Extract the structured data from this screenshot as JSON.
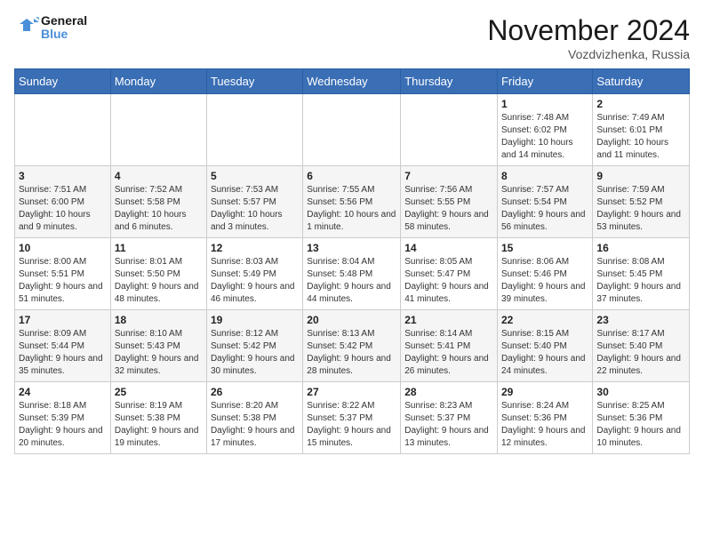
{
  "logo": {
    "line1": "General",
    "line2": "Blue"
  },
  "title": "November 2024",
  "location": "Vozdvizhenka, Russia",
  "weekdays": [
    "Sunday",
    "Monday",
    "Tuesday",
    "Wednesday",
    "Thursday",
    "Friday",
    "Saturday"
  ],
  "weeks": [
    [
      {
        "day": "",
        "info": ""
      },
      {
        "day": "",
        "info": ""
      },
      {
        "day": "",
        "info": ""
      },
      {
        "day": "",
        "info": ""
      },
      {
        "day": "",
        "info": ""
      },
      {
        "day": "1",
        "info": "Sunrise: 7:48 AM\nSunset: 6:02 PM\nDaylight: 10 hours and 14 minutes."
      },
      {
        "day": "2",
        "info": "Sunrise: 7:49 AM\nSunset: 6:01 PM\nDaylight: 10 hours and 11 minutes."
      }
    ],
    [
      {
        "day": "3",
        "info": "Sunrise: 7:51 AM\nSunset: 6:00 PM\nDaylight: 10 hours and 9 minutes."
      },
      {
        "day": "4",
        "info": "Sunrise: 7:52 AM\nSunset: 5:58 PM\nDaylight: 10 hours and 6 minutes."
      },
      {
        "day": "5",
        "info": "Sunrise: 7:53 AM\nSunset: 5:57 PM\nDaylight: 10 hours and 3 minutes."
      },
      {
        "day": "6",
        "info": "Sunrise: 7:55 AM\nSunset: 5:56 PM\nDaylight: 10 hours and 1 minute."
      },
      {
        "day": "7",
        "info": "Sunrise: 7:56 AM\nSunset: 5:55 PM\nDaylight: 9 hours and 58 minutes."
      },
      {
        "day": "8",
        "info": "Sunrise: 7:57 AM\nSunset: 5:54 PM\nDaylight: 9 hours and 56 minutes."
      },
      {
        "day": "9",
        "info": "Sunrise: 7:59 AM\nSunset: 5:52 PM\nDaylight: 9 hours and 53 minutes."
      }
    ],
    [
      {
        "day": "10",
        "info": "Sunrise: 8:00 AM\nSunset: 5:51 PM\nDaylight: 9 hours and 51 minutes."
      },
      {
        "day": "11",
        "info": "Sunrise: 8:01 AM\nSunset: 5:50 PM\nDaylight: 9 hours and 48 minutes."
      },
      {
        "day": "12",
        "info": "Sunrise: 8:03 AM\nSunset: 5:49 PM\nDaylight: 9 hours and 46 minutes."
      },
      {
        "day": "13",
        "info": "Sunrise: 8:04 AM\nSunset: 5:48 PM\nDaylight: 9 hours and 44 minutes."
      },
      {
        "day": "14",
        "info": "Sunrise: 8:05 AM\nSunset: 5:47 PM\nDaylight: 9 hours and 41 minutes."
      },
      {
        "day": "15",
        "info": "Sunrise: 8:06 AM\nSunset: 5:46 PM\nDaylight: 9 hours and 39 minutes."
      },
      {
        "day": "16",
        "info": "Sunrise: 8:08 AM\nSunset: 5:45 PM\nDaylight: 9 hours and 37 minutes."
      }
    ],
    [
      {
        "day": "17",
        "info": "Sunrise: 8:09 AM\nSunset: 5:44 PM\nDaylight: 9 hours and 35 minutes."
      },
      {
        "day": "18",
        "info": "Sunrise: 8:10 AM\nSunset: 5:43 PM\nDaylight: 9 hours and 32 minutes."
      },
      {
        "day": "19",
        "info": "Sunrise: 8:12 AM\nSunset: 5:42 PM\nDaylight: 9 hours and 30 minutes."
      },
      {
        "day": "20",
        "info": "Sunrise: 8:13 AM\nSunset: 5:42 PM\nDaylight: 9 hours and 28 minutes."
      },
      {
        "day": "21",
        "info": "Sunrise: 8:14 AM\nSunset: 5:41 PM\nDaylight: 9 hours and 26 minutes."
      },
      {
        "day": "22",
        "info": "Sunrise: 8:15 AM\nSunset: 5:40 PM\nDaylight: 9 hours and 24 minutes."
      },
      {
        "day": "23",
        "info": "Sunrise: 8:17 AM\nSunset: 5:40 PM\nDaylight: 9 hours and 22 minutes."
      }
    ],
    [
      {
        "day": "24",
        "info": "Sunrise: 8:18 AM\nSunset: 5:39 PM\nDaylight: 9 hours and 20 minutes."
      },
      {
        "day": "25",
        "info": "Sunrise: 8:19 AM\nSunset: 5:38 PM\nDaylight: 9 hours and 19 minutes."
      },
      {
        "day": "26",
        "info": "Sunrise: 8:20 AM\nSunset: 5:38 PM\nDaylight: 9 hours and 17 minutes."
      },
      {
        "day": "27",
        "info": "Sunrise: 8:22 AM\nSunset: 5:37 PM\nDaylight: 9 hours and 15 minutes."
      },
      {
        "day": "28",
        "info": "Sunrise: 8:23 AM\nSunset: 5:37 PM\nDaylight: 9 hours and 13 minutes."
      },
      {
        "day": "29",
        "info": "Sunrise: 8:24 AM\nSunset: 5:36 PM\nDaylight: 9 hours and 12 minutes."
      },
      {
        "day": "30",
        "info": "Sunrise: 8:25 AM\nSunset: 5:36 PM\nDaylight: 9 hours and 10 minutes."
      }
    ]
  ]
}
